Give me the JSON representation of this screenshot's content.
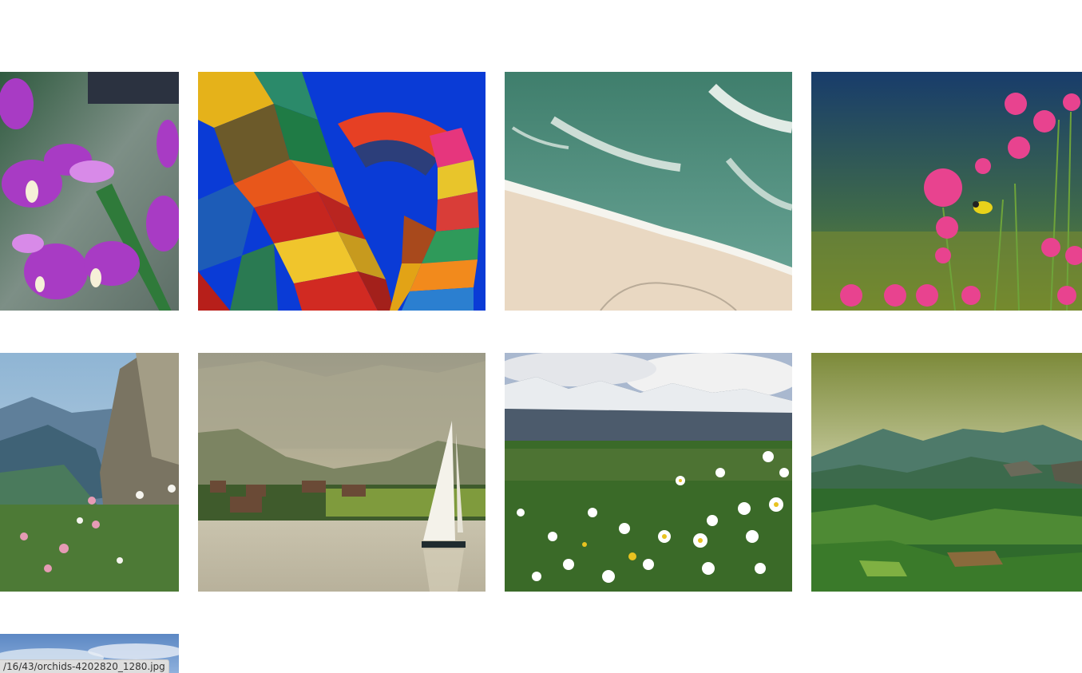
{
  "gallery": {
    "images": [
      {
        "subject": "purple orchids"
      },
      {
        "subject": "colorful shipping container arch"
      },
      {
        "subject": "aerial beach with waves"
      },
      {
        "subject": "pink flowers with yellow bird"
      },
      {
        "subject": "mountain valley with wildflowers"
      },
      {
        "subject": "sailboat on misty lake"
      },
      {
        "subject": "daisy meadow with snowy mountains"
      },
      {
        "subject": "green hills landscape"
      },
      {
        "subject": "sky with clouds"
      }
    ]
  },
  "status": {
    "url": "/16/43/orchids-4202820_1280.jpg"
  },
  "colors": {
    "background": "#ffffff",
    "status_bg": "#dedede",
    "status_text": "#333333"
  }
}
